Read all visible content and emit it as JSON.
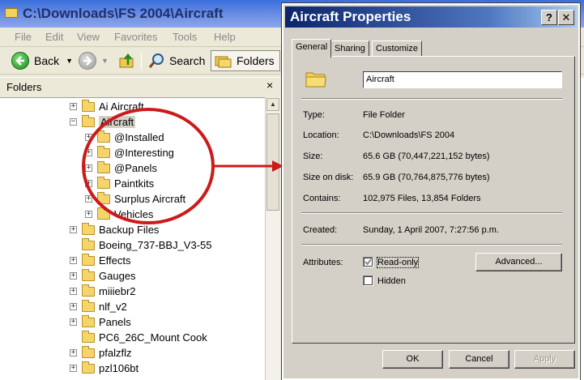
{
  "explorer": {
    "title": "C:\\Downloads\\FS 2004\\Aircraft",
    "menu": [
      "File",
      "Edit",
      "View",
      "Favorites",
      "Tools",
      "Help"
    ],
    "toolbar": {
      "back_label": "Back",
      "search_label": "Search",
      "folders_label": "Folders"
    },
    "folders_pane": {
      "title": "Folders",
      "close_glyph": "×"
    },
    "tree": [
      {
        "label": "Ai Aircraft",
        "level": 0,
        "expander": "+"
      },
      {
        "label": "Aircraft",
        "level": 0,
        "expander": "−",
        "selected": true
      },
      {
        "label": "@Installed",
        "level": 1,
        "expander": "+"
      },
      {
        "label": "@Interesting",
        "level": 1,
        "expander": "+"
      },
      {
        "label": "@Panels",
        "level": 1,
        "expander": "+"
      },
      {
        "label": "Paintkits",
        "level": 1,
        "expander": "+"
      },
      {
        "label": "Surplus Aircraft",
        "level": 1,
        "expander": "+"
      },
      {
        "label": "Vehicles",
        "level": 1,
        "expander": "+"
      },
      {
        "label": "Backup Files",
        "level": 0,
        "expander": "+"
      },
      {
        "label": "Boeing_737-BBJ_V3-55",
        "level": 0,
        "expander": ""
      },
      {
        "label": "Effects",
        "level": 0,
        "expander": "+"
      },
      {
        "label": "Gauges",
        "level": 0,
        "expander": "+"
      },
      {
        "label": "miiiebr2",
        "level": 0,
        "expander": "+"
      },
      {
        "label": "nlf_v2",
        "level": 0,
        "expander": "+"
      },
      {
        "label": "Panels",
        "level": 0,
        "expander": "+"
      },
      {
        "label": "PC6_26C_Mount Cook",
        "level": 0,
        "expander": ""
      },
      {
        "label": "pfalzflz",
        "level": 0,
        "expander": "+"
      },
      {
        "label": "pzl106bt",
        "level": 0,
        "expander": "+"
      }
    ]
  },
  "dialog": {
    "title": "Aircraft Properties",
    "help_glyph": "?",
    "close_glyph": "✕",
    "tabs": [
      "General",
      "Sharing",
      "Customize"
    ],
    "name_value": "Aircraft",
    "properties": {
      "type_label": "Type:",
      "type_value": "File Folder",
      "location_label": "Location:",
      "location_value": "C:\\Downloads\\FS 2004",
      "size_label": "Size:",
      "size_value": "65.6 GB (70,447,221,152 bytes)",
      "size_on_disk_label": "Size on disk:",
      "size_on_disk_value": "65.9 GB (70,764,875,776 bytes)",
      "contains_label": "Contains:",
      "contains_value": "102,975 Files, 13,854 Folders",
      "created_label": "Created:",
      "created_value": "Sunday, 1 April 2007, 7:27:56 p.m."
    },
    "attributes": {
      "label": "Attributes:",
      "readonly_label": "Read-only",
      "readonly_checked": true,
      "hidden_label": "Hidden",
      "hidden_checked": false,
      "advanced_label": "Advanced..."
    },
    "buttons": {
      "ok": "OK",
      "cancel": "Cancel",
      "apply": "Apply"
    }
  },
  "colors": {
    "annotation": "#cc1a1a",
    "dialog_title_start": "#0a246a",
    "dialog_title_end": "#a6caf0"
  }
}
